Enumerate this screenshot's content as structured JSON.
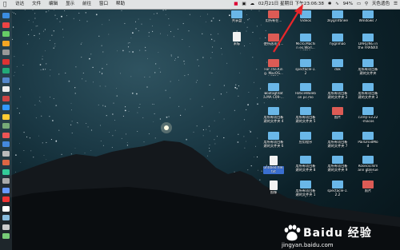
{
  "menubar": {
    "apple": "",
    "menus": [
      "访达",
      "文件",
      "编辑",
      "显示",
      "前往",
      "窗口",
      "帮助"
    ],
    "datetime": "02月21日 星期日 下午23:06:38",
    "battery": "94%",
    "search_tab": "天色遗色"
  },
  "desktop_items": [
    {
      "label": "共享盘",
      "kind": "blue"
    },
    {
      "label": "未标",
      "kind": "doc"
    },
    {
      "label": "用所有在...",
      "kind": "red"
    },
    {
      "label": "Videos",
      "kind": "blue"
    },
    {
      "label": "zkygrnfbnee",
      "kind": "blue"
    },
    {
      "label": "Windows 7",
      "kind": "blue"
    },
    {
      "label": "使所选项目...",
      "kind": "red"
    },
    {
      "label": "Micro.Machin es.Worl...VAT00",
      "kind": "blue"
    },
    {
      "label": "hygnmao",
      "kind": "blue"
    },
    {
      "label": "DARLING in the FRANXX",
      "kind": "blue"
    },
    {
      "label": "For.The.King. MacOS...VAT00",
      "kind": "red"
    },
    {
      "label": "spectacle-1.2",
      "kind": "blue"
    },
    {
      "label": "dok",
      "kind": "blue"
    },
    {
      "label": "用所有项目新建的文件夹",
      "kind": "blue"
    },
    {
      "label": "Bootagtdata.MA C09-... tmtadet",
      "kind": "blue"
    },
    {
      "label": "RoticeWalebon pc.mon...vrderr",
      "kind": "blue"
    },
    {
      "label": "用所有项目新建的文件夹 2",
      "kind": "blue"
    },
    {
      "label": "用所有项目新建的文件夹 3",
      "kind": "blue"
    },
    {
      "label": "用所有项目新建的文件夹 4",
      "kind": "blue"
    },
    {
      "label": "用所有项目新建的文件夹 5",
      "kind": "blue"
    },
    {
      "label": "图片",
      "kind": "red"
    },
    {
      "label": "c3rey-v3.22-macos",
      "kind": "blue"
    },
    {
      "label": "用所有项目新建的文件夹 6",
      "kind": "blue"
    },
    {
      "label": "应用程序",
      "kind": "blue"
    },
    {
      "label": "用所有项目新建的文件夹 7",
      "kind": "blue"
    },
    {
      "label": "PairDroidMod",
      "kind": "blue"
    },
    {
      "label": "untitled file.txt",
      "kind": "doc",
      "selected": true
    },
    {
      "label": "用所有项目新建的文件夹 8",
      "kind": "blue"
    },
    {
      "label": "用所有项目新建的文件夹 9",
      "kind": "blue"
    },
    {
      "label": "Rosecschlmann gbleruer 1.59",
      "kind": "blue"
    },
    {
      "label": "图像",
      "kind": "doc"
    },
    {
      "label": "用所有项目新建的文件夹 10",
      "kind": "blue"
    },
    {
      "label": "spectacle-1.2.2",
      "kind": "blue"
    },
    {
      "label": "照片",
      "kind": "red"
    }
  ],
  "watermark": {
    "brand": "Baidu 经验",
    "url": "jingyan.baidu.com"
  },
  "colors": {
    "folder_blue": "#6ab7e8",
    "folder_red": "#dc5b55",
    "arrow_red": "#e8262a",
    "selection": "#3a6fd1"
  }
}
